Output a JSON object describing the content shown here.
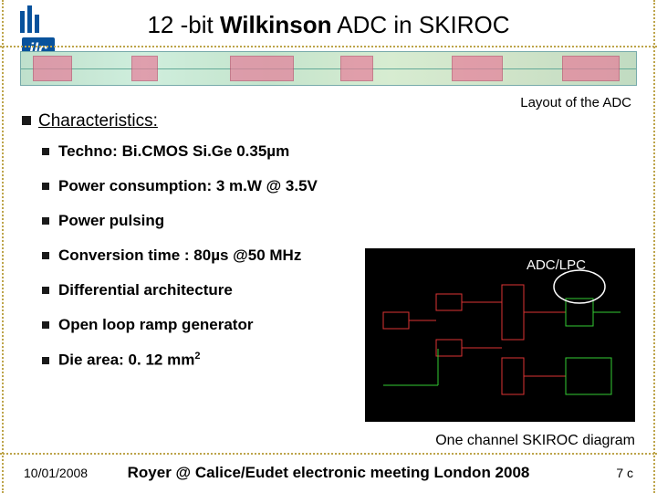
{
  "logo_text": "ilc",
  "title_pre": "12 -bit ",
  "title_bold": "Wilkinson",
  "title_post": " ADC in SKIROC",
  "caption_layout": "Layout of the ADC",
  "section_heading": "Characteristics:",
  "bullets": {
    "techno": "Techno: Bi.CMOS Si.Ge 0.35µm",
    "power": "Power consumption: 3 m.W @ 3.5V",
    "pulsing": "Power pulsing",
    "conv": "Conversion time : 80µs @50 MHz",
    "diff": "Differential architecture",
    "ramp": "Open loop ramp generator",
    "die_pre": "Die area: 0. 12 mm",
    "die_sup": "2"
  },
  "schematic_label": "ADC/LPC",
  "caption_schematic": "One channel SKIROC diagram",
  "footer_date": "10/01/2008",
  "footer_center": "Royer @ Calice/Eudet electronic meeting London 2008",
  "footer_page": "7 c"
}
